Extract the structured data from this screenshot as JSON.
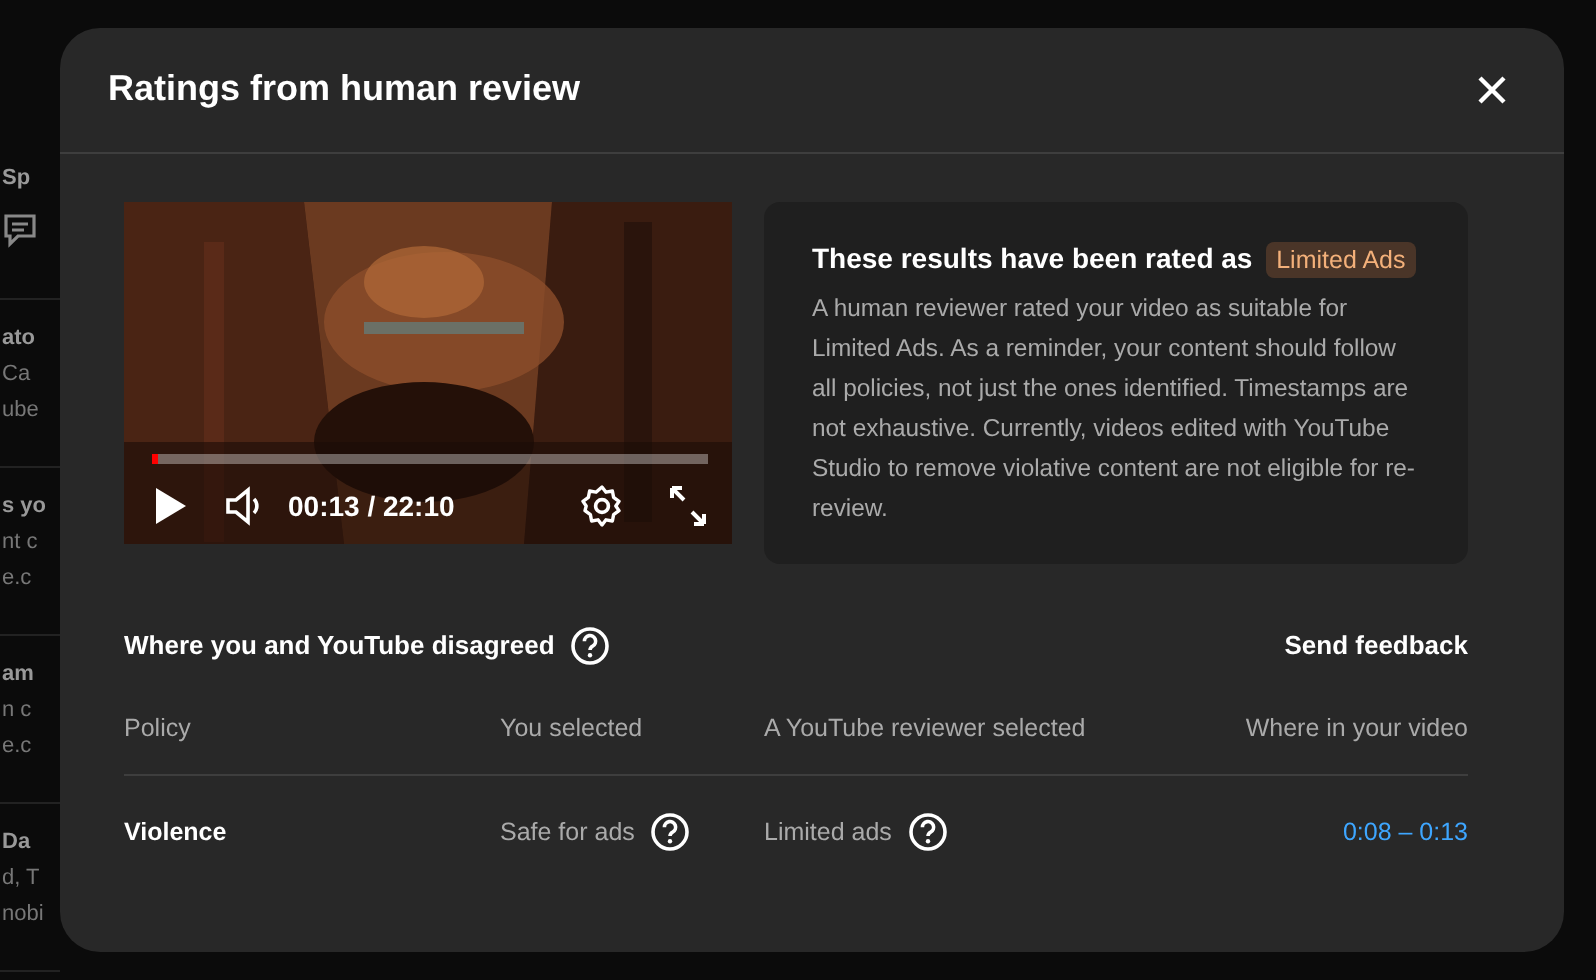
{
  "background_items": [
    {
      "lines": [
        "Sp"
      ],
      "comment_icon": true
    },
    {
      "lines": [
        "ato",
        "Ca",
        "ube"
      ]
    },
    {
      "lines": [
        "s yo",
        "nt c",
        "e.c"
      ]
    },
    {
      "lines": [
        "am",
        "n c",
        "e.c"
      ]
    },
    {
      "lines": [
        "Da",
        "d, T",
        "nobi"
      ]
    }
  ],
  "dialog": {
    "title": "Ratings from human review",
    "video": {
      "kind": "picture",
      "progress": {
        "level": 0.01
      },
      "time": "00:13 / 22:10"
    },
    "result": {
      "heading": "These results have been rated as",
      "rating": "Limited Ads",
      "body": "A human reviewer rated your video as suitable for Limited Ads. As a reminder, your content should follow all policies, not just the ones identified. Timestamps are not exhaustive. Currently, videos edited with YouTube Studio to remove violative content are not eligible for re-review."
    },
    "disagreement": {
      "title": "Where you and YouTube disagreed",
      "feedback": "Send feedback",
      "columns": [
        "Policy",
        "You selected",
        "A YouTube reviewer selected",
        "Where in your video"
      ],
      "rows": [
        {
          "policy": "Violence",
          "you_selected": "Safe for ads",
          "reviewer_selected": "Limited ads",
          "where": "0:08 – 0:13"
        }
      ]
    }
  }
}
